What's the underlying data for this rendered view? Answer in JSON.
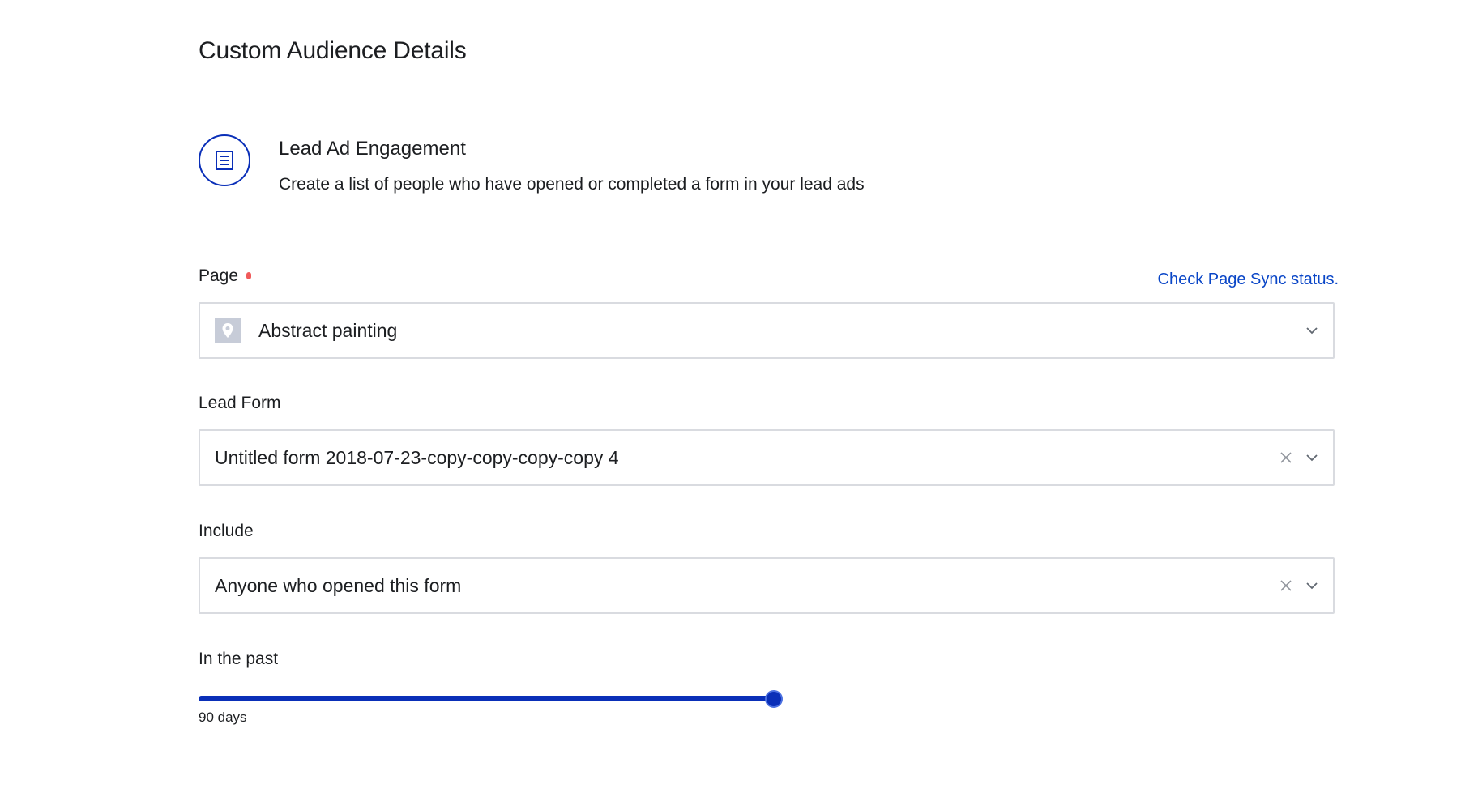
{
  "page_title": "Custom Audience Details",
  "audience_type": {
    "icon": "form-list-icon",
    "title": "Lead Ad Engagement",
    "description": "Create a list of people who have opened or completed a form in your lead ads"
  },
  "page_field": {
    "label": "Page",
    "required": true,
    "sync_link": "Check Page Sync status.",
    "value": "Abstract painting",
    "thumbnail_icon": "location-pin-icon"
  },
  "lead_form_field": {
    "label": "Lead Form",
    "value": "Untitled form 2018-07-23-copy-copy-copy-copy 4"
  },
  "include_field": {
    "label": "Include",
    "value": "Anyone who opened this form"
  },
  "retention": {
    "label": "In the past",
    "value_label": "90 days",
    "fill_fraction": 1.0
  },
  "colors": {
    "accent": "#0a2fb8",
    "link": "#0a46c7",
    "required": "#f05a5a",
    "border": "#d9dbe0"
  }
}
